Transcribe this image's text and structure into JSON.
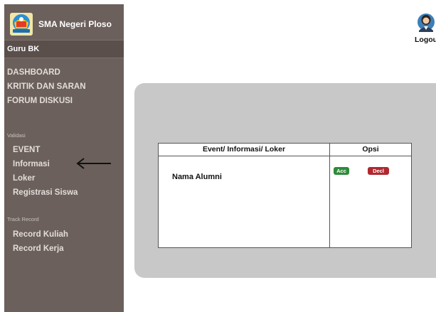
{
  "brand": {
    "name": "SMA Negeri Ploso"
  },
  "user": {
    "role": "Guru BK",
    "logout_label": "Logout"
  },
  "nav": {
    "main": [
      {
        "label": "DASHBOARD"
      },
      {
        "label": "KRITIK DAN SARAN"
      },
      {
        "label": "FORUM DISKUSI"
      }
    ],
    "validasi": {
      "section_label": "Validasi",
      "items": [
        {
          "label": "EVENT"
        },
        {
          "label": "Informasi"
        },
        {
          "label": "Loker"
        },
        {
          "label": "Registrasi Siswa"
        }
      ]
    },
    "track_record": {
      "section_label": "Track Record",
      "items": [
        {
          "label": "Record Kuliah"
        },
        {
          "label": "Record Kerja"
        }
      ]
    }
  },
  "table": {
    "headers": [
      "Event/ Informasi/ Loker",
      "Opsi"
    ],
    "rows": [
      {
        "name": "Nama Alumni",
        "accept_label": "Acc",
        "decline_label": "Decl"
      }
    ]
  },
  "colors": {
    "sidebar_bg": "#6b605c",
    "panel_bg": "#c8c8c8",
    "accept": "#2e8b3a",
    "decline": "#b0282f"
  },
  "icons": {
    "brand_logo": "school-logo-icon",
    "avatar": "user-avatar-icon",
    "pointer": "arrow-left-icon"
  }
}
